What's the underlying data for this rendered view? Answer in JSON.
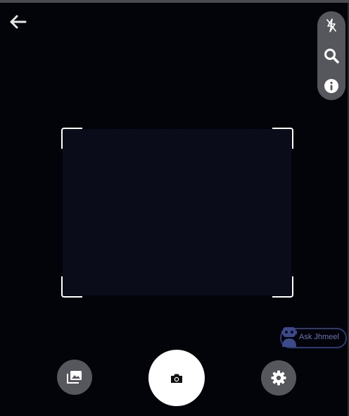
{
  "colors": {
    "background": "#03040a",
    "scan_area": "#0b0c19",
    "control_bg": "#55575c",
    "icon": "#ffffff",
    "assistant_accent": "#2f3a70"
  },
  "header": {
    "back_icon": "arrow-left-icon"
  },
  "side_toolbar": {
    "tools": [
      {
        "name": "flash-off",
        "icon": "flash-off-icon"
      },
      {
        "name": "search",
        "icon": "search-icon"
      },
      {
        "name": "info",
        "icon": "info-icon"
      }
    ]
  },
  "assistant": {
    "label": "Ask Jhmeel",
    "icon": "robot-icon"
  },
  "bottom_controls": {
    "gallery_icon": "gallery-icon",
    "capture_icon": "camera-icon",
    "settings_icon": "gear-icon"
  }
}
